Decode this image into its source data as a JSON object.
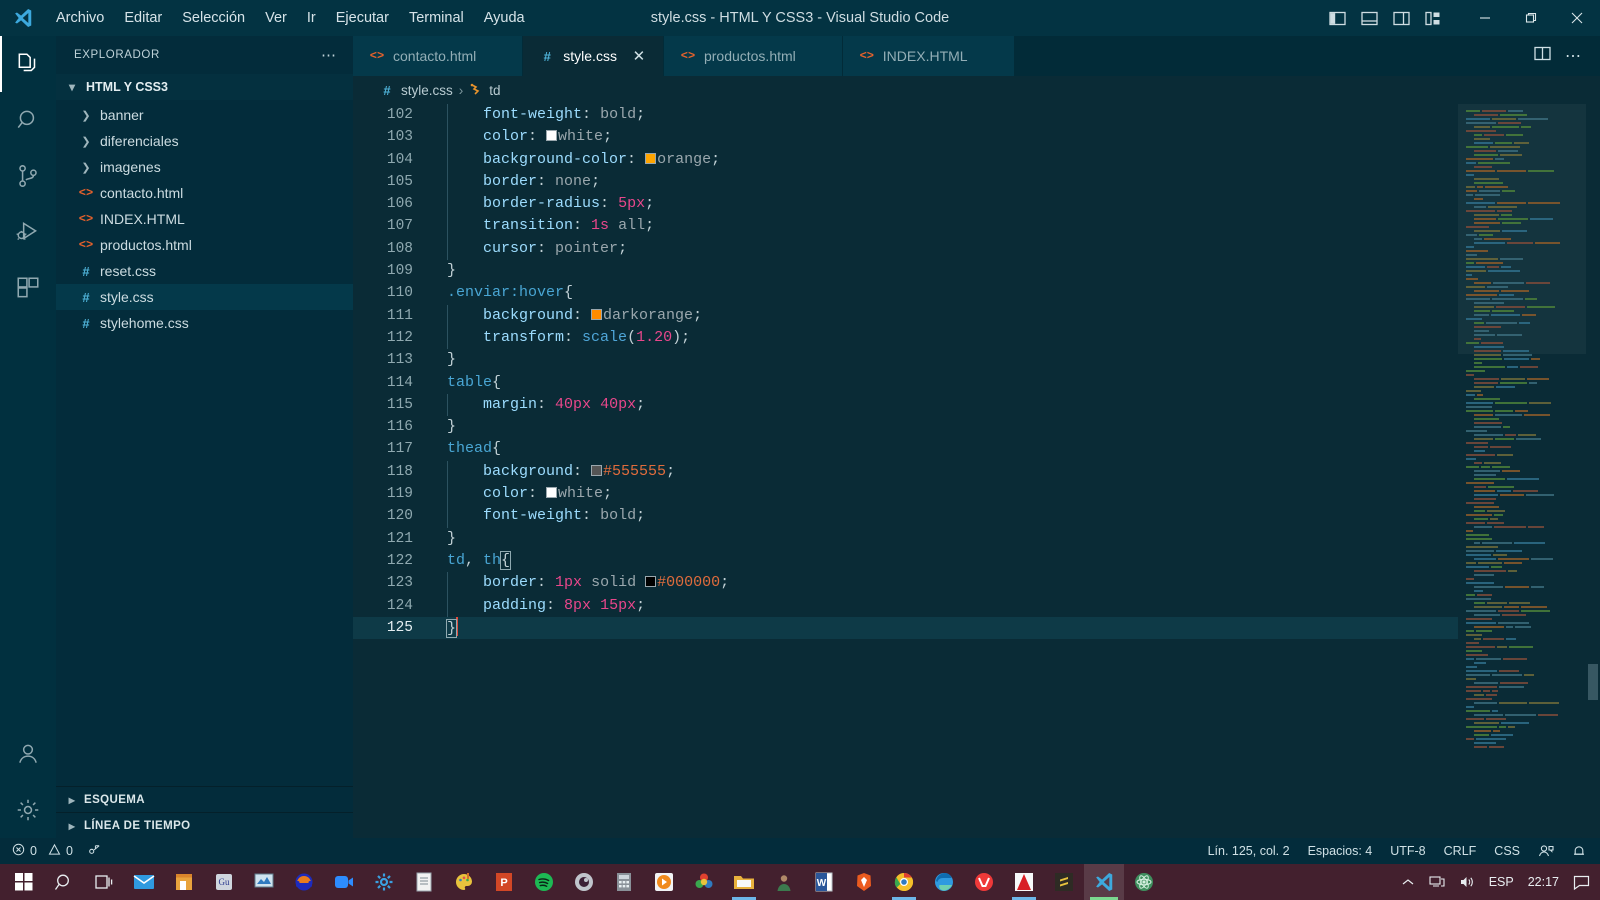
{
  "window": {
    "title": "style.css - HTML Y CSS3 - Visual Studio Code",
    "logo_icon": "vscode-logo-icon",
    "minimize_icon": "minimize-icon",
    "maximize_icon": "maximize-restore-icon",
    "close_icon": "close-icon"
  },
  "menu": {
    "items": [
      {
        "label": "Archivo"
      },
      {
        "label": "Editar"
      },
      {
        "label": "Selección"
      },
      {
        "label": "Ver"
      },
      {
        "label": "Ir"
      },
      {
        "label": "Ejecutar"
      },
      {
        "label": "Terminal"
      },
      {
        "label": "Ayuda"
      }
    ]
  },
  "layout_toggles": [
    {
      "name": "toggle-primary-sidebar-icon"
    },
    {
      "name": "toggle-panel-icon"
    },
    {
      "name": "toggle-secondary-sidebar-icon"
    },
    {
      "name": "customize-layout-icon"
    }
  ],
  "activitybar": {
    "items": [
      {
        "name": "explorer",
        "icon": "files-icon",
        "active": true
      },
      {
        "name": "search",
        "icon": "search-icon",
        "active": false
      },
      {
        "name": "source-control",
        "icon": "source-control-icon",
        "active": false
      },
      {
        "name": "run-and-debug",
        "icon": "run-debug-icon",
        "active": false
      },
      {
        "name": "extensions",
        "icon": "extensions-icon",
        "active": false
      }
    ],
    "bottom": [
      {
        "name": "accounts",
        "icon": "account-icon"
      },
      {
        "name": "manage",
        "icon": "gear-icon"
      }
    ]
  },
  "sidebar": {
    "title": "EXPLORADOR",
    "actions_icon": "ellipsis-icon",
    "root_folder": "HTML Y CSS3",
    "tree": [
      {
        "label": "banner",
        "type": "folder",
        "expanded": false,
        "selected": false
      },
      {
        "label": "diferenciales",
        "type": "folder",
        "expanded": false,
        "selected": false
      },
      {
        "label": "imagenes",
        "type": "folder",
        "expanded": false,
        "selected": false
      },
      {
        "label": "contacto.html",
        "type": "html",
        "expanded": false,
        "selected": false
      },
      {
        "label": "INDEX.HTML",
        "type": "html",
        "expanded": false,
        "selected": false
      },
      {
        "label": "productos.html",
        "type": "html",
        "expanded": false,
        "selected": false
      },
      {
        "label": "reset.css",
        "type": "css",
        "expanded": false,
        "selected": false
      },
      {
        "label": "style.css",
        "type": "css",
        "expanded": false,
        "selected": true
      },
      {
        "label": "stylehome.css",
        "type": "css",
        "expanded": false,
        "selected": false
      }
    ],
    "panels": [
      {
        "label": "ESQUEMA"
      },
      {
        "label": "LÍNEA DE TIEMPO"
      }
    ]
  },
  "tabs": [
    {
      "label": "contacto.html",
      "type": "html",
      "active": false
    },
    {
      "label": "style.css",
      "type": "css",
      "active": true
    },
    {
      "label": "productos.html",
      "type": "html",
      "active": false
    },
    {
      "label": "INDEX.HTML",
      "type": "html",
      "active": false
    }
  ],
  "editor_actions": [
    {
      "name": "split-editor-icon"
    },
    {
      "name": "more-actions-icon"
    }
  ],
  "breadcrumb": {
    "file": "style.css",
    "separator": "›",
    "symbol": "td",
    "file_icon": "css-file-icon",
    "symbol_icon": "css-selector-icon"
  },
  "editor": {
    "first_line": 102,
    "lines": [
      {
        "n": 102,
        "tokens": [
          {
            "t": "indent",
            "v": "    "
          },
          {
            "t": "prop",
            "v": "font-weight"
          },
          {
            "t": "punct",
            "v": ": "
          },
          {
            "t": "val",
            "v": "bold"
          },
          {
            "t": "punct",
            "v": ";"
          }
        ]
      },
      {
        "n": 103,
        "tokens": [
          {
            "t": "indent",
            "v": "    "
          },
          {
            "t": "prop",
            "v": "color"
          },
          {
            "t": "punct",
            "v": ": "
          },
          {
            "t": "swatch",
            "v": "#ffffff"
          },
          {
            "t": "val",
            "v": "white"
          },
          {
            "t": "punct",
            "v": ";"
          }
        ]
      },
      {
        "n": 104,
        "tokens": [
          {
            "t": "indent",
            "v": "    "
          },
          {
            "t": "prop",
            "v": "background-color"
          },
          {
            "t": "punct",
            "v": ": "
          },
          {
            "t": "swatch",
            "v": "#ffa500"
          },
          {
            "t": "val",
            "v": "orange"
          },
          {
            "t": "punct",
            "v": ";"
          }
        ]
      },
      {
        "n": 105,
        "tokens": [
          {
            "t": "indent",
            "v": "    "
          },
          {
            "t": "prop",
            "v": "border"
          },
          {
            "t": "punct",
            "v": ": "
          },
          {
            "t": "val",
            "v": "none"
          },
          {
            "t": "punct",
            "v": ";"
          }
        ]
      },
      {
        "n": 106,
        "tokens": [
          {
            "t": "indent",
            "v": "    "
          },
          {
            "t": "prop",
            "v": "border-radius"
          },
          {
            "t": "punct",
            "v": ": "
          },
          {
            "t": "num",
            "v": "5px"
          },
          {
            "t": "punct",
            "v": ";"
          }
        ]
      },
      {
        "n": 107,
        "tokens": [
          {
            "t": "indent",
            "v": "    "
          },
          {
            "t": "prop",
            "v": "transition"
          },
          {
            "t": "punct",
            "v": ": "
          },
          {
            "t": "num",
            "v": "1s"
          },
          {
            "t": "val",
            "v": " all"
          },
          {
            "t": "punct",
            "v": ";"
          }
        ]
      },
      {
        "n": 108,
        "tokens": [
          {
            "t": "indent",
            "v": "    "
          },
          {
            "t": "prop",
            "v": "cursor"
          },
          {
            "t": "punct",
            "v": ": "
          },
          {
            "t": "val",
            "v": "pointer"
          },
          {
            "t": "punct",
            "v": ";"
          }
        ]
      },
      {
        "n": 109,
        "tokens": [
          {
            "t": "brace",
            "v": "}"
          }
        ]
      },
      {
        "n": 110,
        "tokens": [
          {
            "t": "sel",
            "v": ".enviar:hover"
          },
          {
            "t": "brace",
            "v": "{"
          }
        ]
      },
      {
        "n": 111,
        "tokens": [
          {
            "t": "indent",
            "v": "    "
          },
          {
            "t": "prop",
            "v": "background"
          },
          {
            "t": "punct",
            "v": ": "
          },
          {
            "t": "swatch",
            "v": "#ff8c00"
          },
          {
            "t": "val",
            "v": "darkorange"
          },
          {
            "t": "punct",
            "v": ";"
          }
        ]
      },
      {
        "n": 112,
        "tokens": [
          {
            "t": "indent",
            "v": "    "
          },
          {
            "t": "prop",
            "v": "transform"
          },
          {
            "t": "punct",
            "v": ": "
          },
          {
            "t": "fn",
            "v": "scale"
          },
          {
            "t": "punct",
            "v": "("
          },
          {
            "t": "num",
            "v": "1.20"
          },
          {
            "t": "punct",
            "v": ")"
          },
          {
            "t": "punct",
            "v": ";"
          }
        ]
      },
      {
        "n": 113,
        "tokens": [
          {
            "t": "brace",
            "v": "}"
          }
        ]
      },
      {
        "n": 114,
        "tokens": [
          {
            "t": "sel",
            "v": "table"
          },
          {
            "t": "brace",
            "v": "{"
          }
        ]
      },
      {
        "n": 115,
        "tokens": [
          {
            "t": "indent",
            "v": "    "
          },
          {
            "t": "prop",
            "v": "margin"
          },
          {
            "t": "punct",
            "v": ": "
          },
          {
            "t": "num",
            "v": "40px"
          },
          {
            "t": "punct",
            "v": " "
          },
          {
            "t": "num",
            "v": "40px"
          },
          {
            "t": "punct",
            "v": ";"
          }
        ]
      },
      {
        "n": 116,
        "tokens": [
          {
            "t": "brace",
            "v": "}"
          }
        ]
      },
      {
        "n": 117,
        "tokens": [
          {
            "t": "sel",
            "v": "thead"
          },
          {
            "t": "brace",
            "v": "{"
          }
        ]
      },
      {
        "n": 118,
        "tokens": [
          {
            "t": "indent",
            "v": "    "
          },
          {
            "t": "prop",
            "v": "background"
          },
          {
            "t": "punct",
            "v": ": "
          },
          {
            "t": "swatch",
            "v": "#555555"
          },
          {
            "t": "hex",
            "v": "#555555"
          },
          {
            "t": "punct",
            "v": ";"
          }
        ]
      },
      {
        "n": 119,
        "tokens": [
          {
            "t": "indent",
            "v": "    "
          },
          {
            "t": "prop",
            "v": "color"
          },
          {
            "t": "punct",
            "v": ": "
          },
          {
            "t": "swatch",
            "v": "#ffffff"
          },
          {
            "t": "val",
            "v": "white"
          },
          {
            "t": "punct",
            "v": ";"
          }
        ]
      },
      {
        "n": 120,
        "tokens": [
          {
            "t": "indent",
            "v": "    "
          },
          {
            "t": "prop",
            "v": "font-weight"
          },
          {
            "t": "punct",
            "v": ": "
          },
          {
            "t": "val",
            "v": "bold"
          },
          {
            "t": "punct",
            "v": ";"
          }
        ]
      },
      {
        "n": 121,
        "tokens": [
          {
            "t": "brace",
            "v": "}"
          }
        ]
      },
      {
        "n": 122,
        "tokens": [
          {
            "t": "sel",
            "v": "td"
          },
          {
            "t": "punct",
            "v": ", "
          },
          {
            "t": "sel",
            "v": "th"
          },
          {
            "t": "bracematch",
            "v": "{"
          }
        ]
      },
      {
        "n": 123,
        "tokens": [
          {
            "t": "indent",
            "v": "    "
          },
          {
            "t": "prop",
            "v": "border"
          },
          {
            "t": "punct",
            "v": ": "
          },
          {
            "t": "num",
            "v": "1px"
          },
          {
            "t": "val",
            "v": " solid "
          },
          {
            "t": "swatch",
            "v": "#000000"
          },
          {
            "t": "hex",
            "v": "#000000"
          },
          {
            "t": "punct",
            "v": ";"
          }
        ]
      },
      {
        "n": 124,
        "tokens": [
          {
            "t": "indent",
            "v": "    "
          },
          {
            "t": "prop",
            "v": "padding"
          },
          {
            "t": "punct",
            "v": ": "
          },
          {
            "t": "num",
            "v": "8px"
          },
          {
            "t": "punct",
            "v": " "
          },
          {
            "t": "num",
            "v": "15px"
          },
          {
            "t": "punct",
            "v": ";"
          }
        ]
      },
      {
        "n": 125,
        "tokens": [
          {
            "t": "bracematch",
            "v": "}"
          },
          {
            "t": "cursor",
            "v": ""
          }
        ],
        "current": true
      }
    ]
  },
  "statusbar": {
    "errors_icon": "error-circle-icon",
    "errors": "0",
    "warnings_icon": "warning-triangle-icon",
    "warnings": "0",
    "ports_icon": "radio-tower-icon",
    "position": "Lín. 125, col. 2",
    "indentation": "Espacios: 4",
    "encoding": "UTF-8",
    "eol": "CRLF",
    "language": "CSS",
    "live_share_icon": "live-share-icon",
    "notifications_icon": "bell-icon"
  },
  "taskbar": {
    "items": [
      {
        "name": "start",
        "icon": "windows-start-icon"
      },
      {
        "name": "search",
        "icon": "search-icon"
      },
      {
        "name": "task-view",
        "icon": "task-view-icon"
      },
      {
        "name": "mail",
        "icon": "mail-icon"
      },
      {
        "name": "store",
        "icon": "store-icon"
      },
      {
        "name": "geogebra",
        "icon": "geogebra-icon"
      },
      {
        "name": "media-player",
        "icon": "media-player-icon"
      },
      {
        "name": "audacity",
        "icon": "audacity-icon"
      },
      {
        "name": "zoom",
        "icon": "zoom-icon"
      },
      {
        "name": "settings",
        "icon": "gear-icon"
      },
      {
        "name": "notepad",
        "icon": "notepad-icon"
      },
      {
        "name": "paint",
        "icon": "paint-icon"
      },
      {
        "name": "powerpoint",
        "icon": "powerpoint-icon"
      },
      {
        "name": "spotify",
        "icon": "spotify-icon"
      },
      {
        "name": "obs",
        "icon": "obs-icon"
      },
      {
        "name": "calculator",
        "icon": "calculator-icon"
      },
      {
        "name": "video-player",
        "icon": "video-player-icon"
      },
      {
        "name": "photos",
        "icon": "photos-icon"
      },
      {
        "name": "file-explorer",
        "icon": "folder-icon",
        "running": true
      },
      {
        "name": "contact",
        "icon": "person-icon"
      },
      {
        "name": "word",
        "icon": "word-icon"
      },
      {
        "name": "brave",
        "icon": "brave-icon"
      },
      {
        "name": "chrome",
        "icon": "chrome-icon",
        "running": true
      },
      {
        "name": "edge",
        "icon": "edge-icon"
      },
      {
        "name": "vivaldi",
        "icon": "vivaldi-icon"
      },
      {
        "name": "adobe",
        "icon": "adobe-icon",
        "running": true
      },
      {
        "name": "sublime",
        "icon": "sublime-icon"
      },
      {
        "name": "vscode",
        "icon": "vscode-icon",
        "active": true
      },
      {
        "name": "react",
        "icon": "react-icon"
      }
    ],
    "tray": {
      "expand_icon": "chevron-up-icon",
      "network_icon": "network-icon",
      "volume_icon": "volume-icon",
      "language": "ESP",
      "clock": "22:17",
      "action_center_icon": "action-center-icon"
    }
  }
}
